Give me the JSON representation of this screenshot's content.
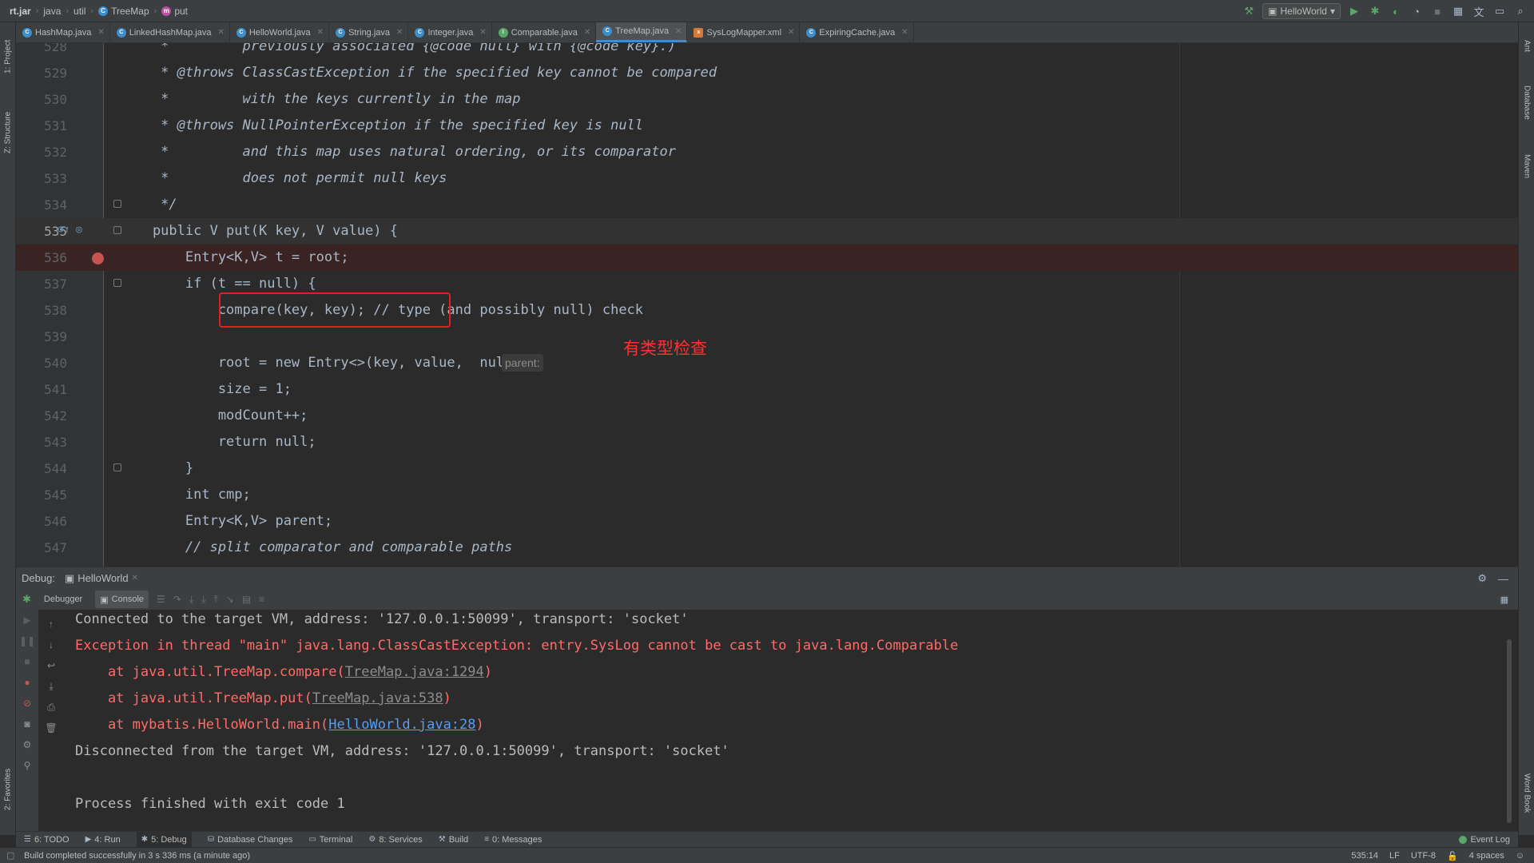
{
  "breadcrumb": {
    "items": [
      "rt.jar",
      "java",
      "util",
      "TreeMap",
      "put"
    ]
  },
  "toolbar": {
    "run_config": "HelloWorld"
  },
  "tabs": [
    {
      "label": "HashMap.java",
      "kind": "class",
      "active": false
    },
    {
      "label": "LinkedHashMap.java",
      "kind": "class",
      "active": false
    },
    {
      "label": "HelloWorld.java",
      "kind": "class",
      "active": false
    },
    {
      "label": "String.java",
      "kind": "class",
      "active": false
    },
    {
      "label": "Integer.java",
      "kind": "class",
      "active": false
    },
    {
      "label": "Comparable.java",
      "kind": "interface",
      "active": false
    },
    {
      "label": "TreeMap.java",
      "kind": "class",
      "active": true
    },
    {
      "label": "SysLogMapper.xml",
      "kind": "xml",
      "active": false
    },
    {
      "label": "ExpiringCache.java",
      "kind": "class",
      "active": false
    }
  ],
  "editor": {
    "lines": [
      {
        "num": "528",
        "text": "     *         previously associated {@code null} with {@code key}.)"
      },
      {
        "num": "529",
        "text": "     * @throws ClassCastException if the specified key cannot be compared"
      },
      {
        "num": "530",
        "text": "     *         with the keys currently in the map"
      },
      {
        "num": "531",
        "text": "     * @throws NullPointerException if the specified key is null"
      },
      {
        "num": "532",
        "text": "     *         and this map uses natural ordering, or its comparator"
      },
      {
        "num": "533",
        "text": "     *         does not permit null keys"
      },
      {
        "num": "534",
        "text": "     */"
      },
      {
        "num": "535",
        "text": "    public V put(K key, V value) {"
      },
      {
        "num": "536",
        "text": "        Entry<K,V> t = root;"
      },
      {
        "num": "537",
        "text": "        if (t == null) {"
      },
      {
        "num": "538",
        "text": "            compare(key, key); // type (and possibly null) check"
      },
      {
        "num": "539",
        "text": ""
      },
      {
        "num": "540",
        "text": "            root = new Entry<>(key, value,  null);"
      },
      {
        "num": "541",
        "text": "            size = 1;"
      },
      {
        "num": "542",
        "text": "            modCount++;"
      },
      {
        "num": "543",
        "text": "            return null;"
      },
      {
        "num": "544",
        "text": "        }"
      },
      {
        "num": "545",
        "text": "        int cmp;"
      },
      {
        "num": "546",
        "text": "        Entry<K,V> parent;"
      },
      {
        "num": "547",
        "text": "        // split comparator and comparable paths"
      }
    ],
    "param_hint": "parent:",
    "annotation": "有类型检查"
  },
  "debug": {
    "label": "Debug:",
    "session_tab": "HelloWorld",
    "debugger_tab": "Debugger",
    "console_tab": "Console"
  },
  "console": {
    "line1": "Connected to the target VM, address: '127.0.0.1:50099', transport: 'socket'",
    "line2": "Exception in thread \"main\" java.lang.ClassCastException: entry.SysLog cannot be cast to java.lang.Comparable",
    "line3_prefix": "    at java.util.TreeMap.compare(",
    "line3_link": "TreeMap.java:1294",
    "line4_prefix": "    at java.util.TreeMap.put(",
    "line4_link": "TreeMap.java:538",
    "line5_prefix": "    at mybatis.HelloWorld.main(",
    "line5_link": "HelloWorld.java:28",
    "close_paren": ")",
    "line6": "Disconnected from the target VM, address: '127.0.0.1:50099', transport: 'socket'",
    "line7": "Process finished with exit code 1"
  },
  "tool_windows": [
    {
      "label": "6: TODO",
      "icon": "list-icon"
    },
    {
      "label": "4: Run",
      "icon": "run-icon"
    },
    {
      "label": "5: Debug",
      "icon": "bug-icon",
      "active": true
    },
    {
      "label": "Database Changes",
      "icon": "database-icon"
    },
    {
      "label": "Terminal",
      "icon": "terminal-icon"
    },
    {
      "label": "8: Services",
      "icon": "services-icon"
    },
    {
      "label": "Build",
      "icon": "hammer-icon"
    },
    {
      "label": "0: Messages",
      "icon": "messages-icon"
    }
  ],
  "event_log": "Event Log",
  "left_stripe": {
    "project": "1: Project",
    "structure": "Z: Structure",
    "favorites": "2: Favorites"
  },
  "right_stripe": {
    "ant": "Ant",
    "database": "Database",
    "maven": "Maven",
    "wordbook": "Word Book"
  },
  "status": {
    "message": "Build completed successfully in 3 s 336 ms (a minute ago)",
    "position": "535:14",
    "line_sep": "LF",
    "encoding": "UTF-8",
    "indent": "4 spaces"
  }
}
